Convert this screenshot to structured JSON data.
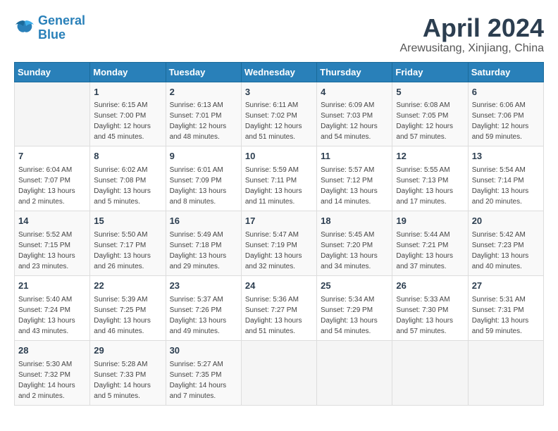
{
  "header": {
    "logo_line1": "General",
    "logo_line2": "Blue",
    "month_title": "April 2024",
    "location": "Arewusitang, Xinjiang, China"
  },
  "days_of_week": [
    "Sunday",
    "Monday",
    "Tuesday",
    "Wednesday",
    "Thursday",
    "Friday",
    "Saturday"
  ],
  "weeks": [
    [
      {
        "day": "",
        "info": ""
      },
      {
        "day": "1",
        "info": "Sunrise: 6:15 AM\nSunset: 7:00 PM\nDaylight: 12 hours\nand 45 minutes."
      },
      {
        "day": "2",
        "info": "Sunrise: 6:13 AM\nSunset: 7:01 PM\nDaylight: 12 hours\nand 48 minutes."
      },
      {
        "day": "3",
        "info": "Sunrise: 6:11 AM\nSunset: 7:02 PM\nDaylight: 12 hours\nand 51 minutes."
      },
      {
        "day": "4",
        "info": "Sunrise: 6:09 AM\nSunset: 7:03 PM\nDaylight: 12 hours\nand 54 minutes."
      },
      {
        "day": "5",
        "info": "Sunrise: 6:08 AM\nSunset: 7:05 PM\nDaylight: 12 hours\nand 57 minutes."
      },
      {
        "day": "6",
        "info": "Sunrise: 6:06 AM\nSunset: 7:06 PM\nDaylight: 12 hours\nand 59 minutes."
      }
    ],
    [
      {
        "day": "7",
        "info": "Sunrise: 6:04 AM\nSunset: 7:07 PM\nDaylight: 13 hours\nand 2 minutes."
      },
      {
        "day": "8",
        "info": "Sunrise: 6:02 AM\nSunset: 7:08 PM\nDaylight: 13 hours\nand 5 minutes."
      },
      {
        "day": "9",
        "info": "Sunrise: 6:01 AM\nSunset: 7:09 PM\nDaylight: 13 hours\nand 8 minutes."
      },
      {
        "day": "10",
        "info": "Sunrise: 5:59 AM\nSunset: 7:11 PM\nDaylight: 13 hours\nand 11 minutes."
      },
      {
        "day": "11",
        "info": "Sunrise: 5:57 AM\nSunset: 7:12 PM\nDaylight: 13 hours\nand 14 minutes."
      },
      {
        "day": "12",
        "info": "Sunrise: 5:55 AM\nSunset: 7:13 PM\nDaylight: 13 hours\nand 17 minutes."
      },
      {
        "day": "13",
        "info": "Sunrise: 5:54 AM\nSunset: 7:14 PM\nDaylight: 13 hours\nand 20 minutes."
      }
    ],
    [
      {
        "day": "14",
        "info": "Sunrise: 5:52 AM\nSunset: 7:15 PM\nDaylight: 13 hours\nand 23 minutes."
      },
      {
        "day": "15",
        "info": "Sunrise: 5:50 AM\nSunset: 7:17 PM\nDaylight: 13 hours\nand 26 minutes."
      },
      {
        "day": "16",
        "info": "Sunrise: 5:49 AM\nSunset: 7:18 PM\nDaylight: 13 hours\nand 29 minutes."
      },
      {
        "day": "17",
        "info": "Sunrise: 5:47 AM\nSunset: 7:19 PM\nDaylight: 13 hours\nand 32 minutes."
      },
      {
        "day": "18",
        "info": "Sunrise: 5:45 AM\nSunset: 7:20 PM\nDaylight: 13 hours\nand 34 minutes."
      },
      {
        "day": "19",
        "info": "Sunrise: 5:44 AM\nSunset: 7:21 PM\nDaylight: 13 hours\nand 37 minutes."
      },
      {
        "day": "20",
        "info": "Sunrise: 5:42 AM\nSunset: 7:23 PM\nDaylight: 13 hours\nand 40 minutes."
      }
    ],
    [
      {
        "day": "21",
        "info": "Sunrise: 5:40 AM\nSunset: 7:24 PM\nDaylight: 13 hours\nand 43 minutes."
      },
      {
        "day": "22",
        "info": "Sunrise: 5:39 AM\nSunset: 7:25 PM\nDaylight: 13 hours\nand 46 minutes."
      },
      {
        "day": "23",
        "info": "Sunrise: 5:37 AM\nSunset: 7:26 PM\nDaylight: 13 hours\nand 49 minutes."
      },
      {
        "day": "24",
        "info": "Sunrise: 5:36 AM\nSunset: 7:27 PM\nDaylight: 13 hours\nand 51 minutes."
      },
      {
        "day": "25",
        "info": "Sunrise: 5:34 AM\nSunset: 7:29 PM\nDaylight: 13 hours\nand 54 minutes."
      },
      {
        "day": "26",
        "info": "Sunrise: 5:33 AM\nSunset: 7:30 PM\nDaylight: 13 hours\nand 57 minutes."
      },
      {
        "day": "27",
        "info": "Sunrise: 5:31 AM\nSunset: 7:31 PM\nDaylight: 13 hours\nand 59 minutes."
      }
    ],
    [
      {
        "day": "28",
        "info": "Sunrise: 5:30 AM\nSunset: 7:32 PM\nDaylight: 14 hours\nand 2 minutes."
      },
      {
        "day": "29",
        "info": "Sunrise: 5:28 AM\nSunset: 7:33 PM\nDaylight: 14 hours\nand 5 minutes."
      },
      {
        "day": "30",
        "info": "Sunrise: 5:27 AM\nSunset: 7:35 PM\nDaylight: 14 hours\nand 7 minutes."
      },
      {
        "day": "",
        "info": ""
      },
      {
        "day": "",
        "info": ""
      },
      {
        "day": "",
        "info": ""
      },
      {
        "day": "",
        "info": ""
      }
    ]
  ]
}
